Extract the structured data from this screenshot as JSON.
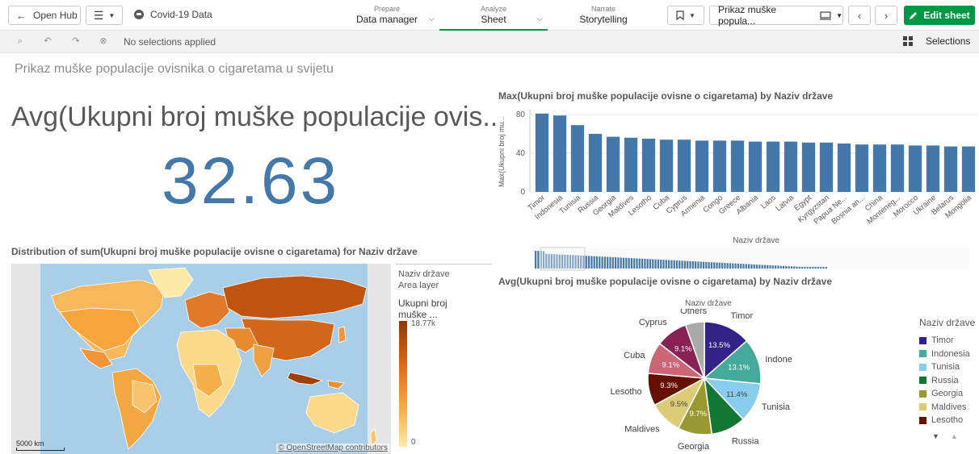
{
  "topbar": {
    "open_hub": "Open Hub",
    "app_title": "Covid-19 Data",
    "tabs": [
      {
        "small": "Prepare",
        "label": "Data manager"
      },
      {
        "small": "Analyze",
        "label": "Sheet"
      },
      {
        "small": "Narrate",
        "label": "Storytelling"
      }
    ],
    "sheet_selector": "Prikaz muške popula...",
    "edit_sheet": "Edit sheet"
  },
  "selections": {
    "status": "No selections applied",
    "label": "Selections"
  },
  "sheet_title": "Prikaz muške populacije ovisnika o cigaretama u svijetu",
  "kpi": {
    "label": "Avg(Ukupni broj muške populacije ovis...",
    "value": "32.63"
  },
  "bar_chart": {
    "title": "Max(Ukupni broj muške populacije ovisne o cigaretama) by Naziv države",
    "ylabel": "Max(Ukupni broj mu...",
    "xlabel": "Naziv države",
    "color": "#4477aa"
  },
  "map": {
    "title": "Distribution of sum(Ukupni broj muške populacije ovisne o cigaretama) for Naziv države",
    "legend_dim": "Naziv države",
    "legend_layer": "Area layer",
    "legend_measure_1": "Ukupni broj",
    "legend_measure_2": "muške ...",
    "legend_max": "18.77k",
    "legend_min": "0",
    "scale": "5000 km",
    "attribution": "© OpenStreetMap contributors",
    "ocean_color": "#a9cfe8"
  },
  "pie_chart": {
    "title": "Avg(Ukupni broj muške populacije ovisne o cigaretama) by Naziv države",
    "dim_label": "Naziv države",
    "legend_title": "Naziv države",
    "legend_items": [
      {
        "label": "Timor",
        "color": "#332288"
      },
      {
        "label": "Indonesia",
        "color": "#44aa99"
      },
      {
        "label": "Tunisia",
        "color": "#88ccee"
      },
      {
        "label": "Russia",
        "color": "#117733"
      },
      {
        "label": "Georgia",
        "color": "#999933"
      },
      {
        "label": "Maldives",
        "color": "#ddcc77"
      },
      {
        "label": "Lesotho",
        "color": "#661100"
      }
    ]
  },
  "chart_data": [
    {
      "type": "bar",
      "title": "Max(Ukupni broj muške populacije ovisne o cigaretama) by Naziv države",
      "xlabel": "Naziv države",
      "ylabel": "Max(Ukupni broj mu...",
      "ylim": [
        0,
        85
      ],
      "yticks": [
        0,
        40,
        80
      ],
      "categories": [
        "Timor",
        "Indonesia",
        "Tunisia",
        "Russia",
        "Georgia",
        "Maldives",
        "Lesotho",
        "Cuba",
        "Cyprus",
        "Armenia",
        "Congo",
        "Greece",
        "Albania",
        "Laos",
        "Latvia",
        "Egypt",
        "Kyrgyzstan",
        "Papua Ne...",
        "Bosnia an...",
        "China",
        "Monteneg...",
        "Morocco",
        "Ukraine",
        "Belarus",
        "Mongolia"
      ],
      "values": [
        81,
        79,
        69,
        60,
        57,
        56,
        55,
        54,
        54,
        53,
        53,
        53,
        52,
        52,
        52,
        51,
        51,
        50,
        49,
        49,
        49,
        48,
        48,
        47,
        47
      ]
    },
    {
      "type": "pie",
      "title": "Avg(Ukupni broj muške populacije ovisne o cigaretama) by Naziv države",
      "slices": [
        {
          "label": "Timor",
          "value": 13.5,
          "text": "13.5%",
          "color": "#332288"
        },
        {
          "label": "Indonesia",
          "value": 13.1,
          "text": "13.1%",
          "color": "#44aa99"
        },
        {
          "label": "Tunisia",
          "value": 11.4,
          "text": "11.4%",
          "color": "#88ccee"
        },
        {
          "label": "Russia",
          "value": 9.9,
          "text": "",
          "color": "#117733"
        },
        {
          "label": "Georgia",
          "value": 9.7,
          "text": "9.7%",
          "color": "#999933"
        },
        {
          "label": "Maldives",
          "value": 9.5,
          "text": "9.5%",
          "color": "#ddcc77"
        },
        {
          "label": "Lesotho",
          "value": 9.3,
          "text": "9.3%",
          "color": "#661100"
        },
        {
          "label": "Cuba",
          "value": 9.1,
          "text": "9.1%",
          "color": "#cc6677"
        },
        {
          "label": "Cyprus",
          "value": 9.1,
          "text": "9.1%",
          "color": "#882255"
        },
        {
          "label": "Others",
          "value": 5.4,
          "text": "",
          "color": "#aaaaaa"
        }
      ]
    }
  ]
}
